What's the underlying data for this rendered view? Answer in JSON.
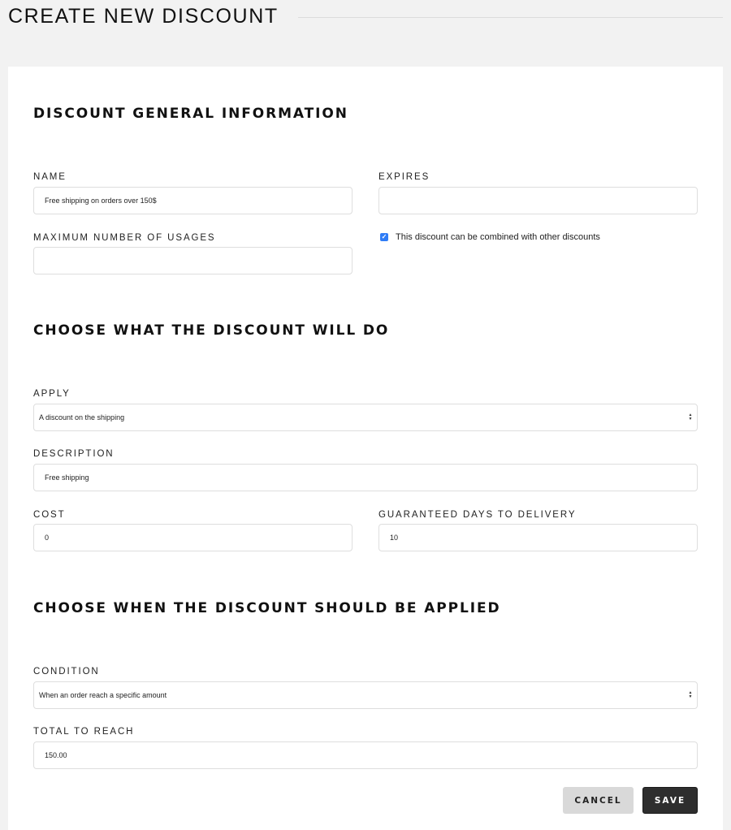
{
  "page": {
    "title": "CREATE NEW DISCOUNT"
  },
  "sections": {
    "general": {
      "title": "DISCOUNT GENERAL INFORMATION",
      "name": {
        "label": "NAME",
        "value": "Free shipping on orders over 150$"
      },
      "expires": {
        "label": "EXPIRES",
        "value": ""
      },
      "max_usages": {
        "label": "MAXIMUM NUMBER OF USAGES",
        "value": ""
      },
      "combinable": {
        "label": "This discount can be combined with other discounts",
        "checked": true
      }
    },
    "action": {
      "title": "CHOOSE WHAT THE DISCOUNT WILL DO",
      "apply": {
        "label": "APPLY",
        "selected": "A discount on the shipping"
      },
      "description": {
        "label": "DESCRIPTION",
        "value": "Free shipping"
      },
      "cost": {
        "label": "COST",
        "value": "0"
      },
      "days": {
        "label": "GUARANTEED DAYS TO DELIVERY",
        "value": "10"
      }
    },
    "condition": {
      "title": "CHOOSE WHEN THE DISCOUNT SHOULD BE APPLIED",
      "condition": {
        "label": "CONDITION",
        "selected": "When an order reach a specific amount"
      },
      "total": {
        "label": "TOTAL TO REACH",
        "value": "150.00"
      }
    }
  },
  "actions": {
    "cancel_label": "CANCEL",
    "save_label": "SAVE"
  },
  "icons": {
    "select_arrows": "up-down-arrows",
    "checkbox_check": "check-mark"
  },
  "colors": {
    "checkbox_accent": "#2f7cf6",
    "save_button_bg": "#2e2e2e",
    "cancel_button_bg": "#d9d9d9",
    "page_bg": "#f2f2f2"
  }
}
